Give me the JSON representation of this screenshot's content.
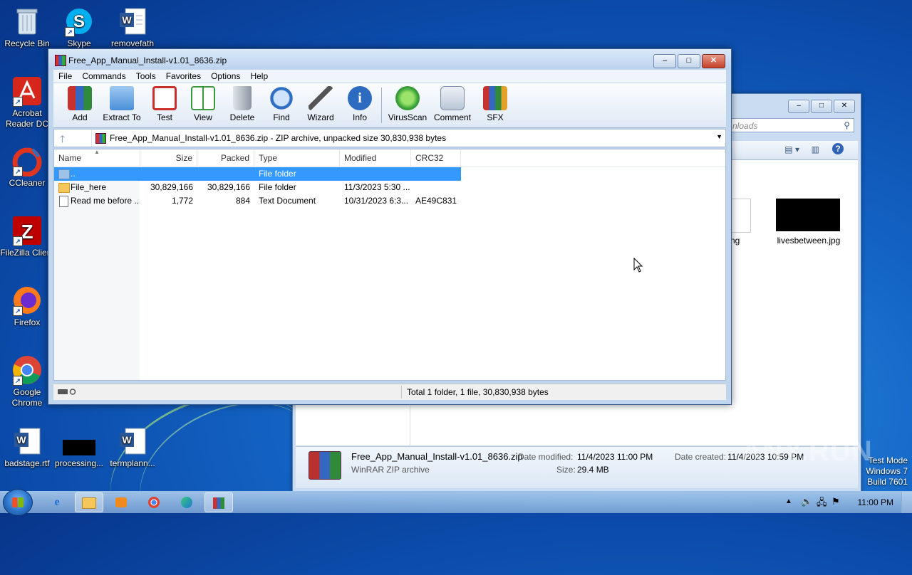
{
  "desktop": {
    "icons": [
      {
        "label": "Recycle Bin"
      },
      {
        "label": "Skype"
      },
      {
        "label": "removefath"
      },
      {
        "label": "Acrobat Reader DC"
      },
      {
        "label": "CCleaner"
      },
      {
        "label": "FileZilla Client"
      },
      {
        "label": "Firefox"
      },
      {
        "label": "Google Chrome"
      },
      {
        "label": "badstage.rtf"
      },
      {
        "label": "processing..."
      },
      {
        "label": "termplann..."
      }
    ]
  },
  "explorer": {
    "search_placeholder": "nloads",
    "files": [
      {
        "label": "ng"
      },
      {
        "label": "livesbetween.jpg"
      }
    ],
    "details": {
      "filename": "Free_App_Manual_Install-v1.01_8636.zip",
      "filetype": "WinRAR ZIP archive",
      "modified_label": "Date modified:",
      "modified_value": "11/4/2023 11:00 PM",
      "size_label": "Size:",
      "size_value": "29.4 MB",
      "created_label": "Date created:",
      "created_value": "11/4/2023 10:59 PM"
    }
  },
  "rar": {
    "title": "Free_App_Manual_Install-v1.01_8636.zip",
    "menu": [
      "File",
      "Commands",
      "Tools",
      "Favorites",
      "Options",
      "Help"
    ],
    "toolbar": [
      {
        "label": "Add",
        "icon": "add-archive-icon",
        "color": "#d8453a"
      },
      {
        "label": "Extract To",
        "icon": "extract-folder-icon",
        "color": "#4a8fd8"
      },
      {
        "label": "Test",
        "icon": "test-clipboard-icon",
        "color": "#c9302c"
      },
      {
        "label": "View",
        "icon": "view-book-icon",
        "color": "#3b9a3b"
      },
      {
        "label": "Delete",
        "icon": "trash-icon",
        "color": "#8c96a3"
      },
      {
        "label": "Find",
        "icon": "magnifier-icon",
        "color": "#2e6fc4"
      },
      {
        "label": "Wizard",
        "icon": "wand-icon",
        "color": "#6a9f3a"
      },
      {
        "label": "Info",
        "icon": "info-icon",
        "color": "#2c6bc0"
      },
      {
        "label": "VirusScan",
        "icon": "virus-scan-icon",
        "color": "#3aa33a"
      },
      {
        "label": "Comment",
        "icon": "comment-icon",
        "color": "#7d8fa8"
      },
      {
        "label": "SFX",
        "icon": "sfx-archive-icon",
        "color": "#d86a2a"
      }
    ],
    "address": "Free_App_Manual_Install-v1.01_8636.zip - ZIP archive, unpacked size 30,830,938 bytes",
    "columns": {
      "name": "Name",
      "size": "Size",
      "packed": "Packed",
      "type": "Type",
      "modified": "Modified",
      "crc": "CRC32"
    },
    "rows": [
      {
        "name": "..",
        "size": "",
        "packed": "",
        "type": "File folder",
        "modified": "",
        "crc": ""
      },
      {
        "name": "File_here",
        "size": "30,829,166",
        "packed": "30,829,166",
        "type": "File folder",
        "modified": "11/3/2023 5:30 ...",
        "crc": ""
      },
      {
        "name": "Read me before ...",
        "size": "1,772",
        "packed": "884",
        "type": "Text Document",
        "modified": "10/31/2023 6:3...",
        "crc": "AE49C831"
      }
    ],
    "status": "Total 1 folder, 1 file, 30,830,938 bytes"
  },
  "taskbar": {
    "clock": "11:00 PM"
  },
  "overlay": {
    "watermark": "ANY.RUN",
    "testmode_line1": "Test Mode",
    "testmode_line2": "Windows 7",
    "testmode_line3": "Build 7601"
  }
}
